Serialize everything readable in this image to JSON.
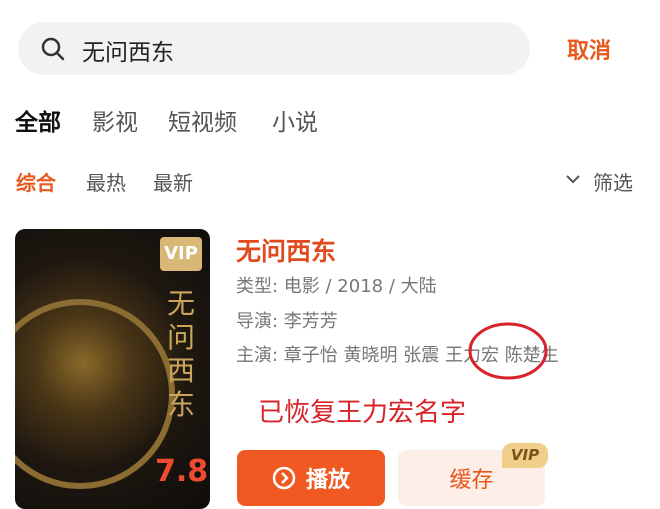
{
  "search": {
    "query": "无问西东",
    "cancel": "取消",
    "icon": "search-icon"
  },
  "tabs": [
    "全部",
    "影视",
    "短视频",
    "小说"
  ],
  "sort": {
    "options": [
      "综合",
      "最热",
      "最新"
    ],
    "filter": "筛选"
  },
  "result": {
    "title": "无问西东",
    "poster_title": "无问西东",
    "vip": "VIP",
    "rating": "7.8",
    "type": "类型: 电影 / 2018 / 大陆",
    "director": "导演: 李芳芳",
    "cast_label": "主演: ",
    "cast": [
      "章子怡",
      "黄晓明",
      "张震",
      "王力宏",
      "陈楚生"
    ],
    "play": "播放",
    "cache": "缓存",
    "cache_badge": "VIP"
  },
  "annotation": "已恢复王力宏名字",
  "colors": {
    "accent": "#e8581c",
    "annotation": "#d8232a"
  }
}
